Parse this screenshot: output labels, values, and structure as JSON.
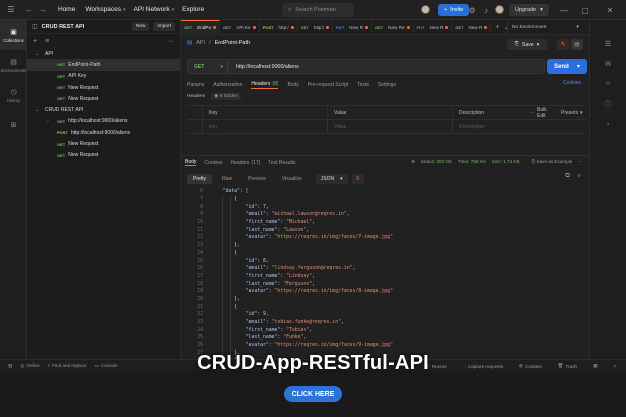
{
  "topbar": {
    "nav": [
      "Home",
      "Workspaces",
      "API Network",
      "Explore"
    ],
    "search_placeholder": "Search Postman",
    "invite_label": "Invite",
    "upgrade_label": "Upgrade"
  },
  "rail": {
    "items": [
      {
        "label": "Collections",
        "icon": "collections-icon"
      },
      {
        "label": "Environments",
        "icon": "environments-icon"
      },
      {
        "label": "History",
        "icon": "history-icon"
      },
      {
        "label": "",
        "icon": "apps-icon"
      }
    ]
  },
  "sidebar": {
    "workspace_title": "CRUD REST API",
    "new_label": "New",
    "import_label": "Import",
    "tree": [
      {
        "depth": 0,
        "chevron": "v",
        "method": "",
        "label": "API"
      },
      {
        "depth": 1,
        "chevron": "",
        "method": "GET",
        "label": "EndPoint-Path",
        "selected": true
      },
      {
        "depth": 1,
        "chevron": "",
        "method": "GET",
        "label": "API Key"
      },
      {
        "depth": 1,
        "chevron": "",
        "method": "GET",
        "label": "New Request"
      },
      {
        "depth": 1,
        "chevron": "",
        "method": "GET",
        "label": "New Request"
      },
      {
        "depth": 0,
        "chevron": "v",
        "method": "",
        "label": "CRUD REST API"
      },
      {
        "depth": 1,
        "chevron": ">",
        "method": "GET",
        "label": "http://localhost:9000/aliens"
      },
      {
        "depth": 1,
        "chevron": "",
        "method": "POST",
        "label": "http://localhost:9000/aliens"
      },
      {
        "depth": 1,
        "chevron": "",
        "method": "GET",
        "label": "New Request"
      },
      {
        "depth": 1,
        "chevron": "",
        "method": "GET",
        "label": "New Request"
      }
    ]
  },
  "tabs": [
    {
      "method": "GET",
      "label": "EndPo",
      "active": true
    },
    {
      "method": "GET",
      "label": "API Ke"
    },
    {
      "method": "POST",
      "label": "http:/"
    },
    {
      "method": "GET",
      "label": "http:/"
    },
    {
      "method": "PUT",
      "label": "New R"
    },
    {
      "method": "GET",
      "label": "New Re"
    },
    {
      "method": "PUT",
      "label": "New R"
    },
    {
      "method": "GET",
      "label": "New R"
    }
  ],
  "environment": "No Environment",
  "request": {
    "breadcrumb_parent": "API",
    "breadcrumb_current": "EndPoint-Path",
    "save_label": "Save",
    "method": "GET",
    "url": "http://localhost:9000/aliens",
    "send_label": "Send",
    "tabs": [
      {
        "label": "Params"
      },
      {
        "label": "Authorization"
      },
      {
        "label": "Headers",
        "count": "(8)",
        "active": true
      },
      {
        "label": "Body"
      },
      {
        "label": "Pre-request Script"
      },
      {
        "label": "Tests"
      },
      {
        "label": "Settings"
      }
    ],
    "cookies_label": "Cookies",
    "headers_label": "Headers",
    "hidden_label": "8 hidden",
    "table_headers": [
      "",
      "Key",
      "Value",
      "Description",
      "Bulk Edit",
      "Presets"
    ],
    "placeholders": [
      "Key",
      "Value",
      "Description"
    ]
  },
  "response": {
    "tabs": [
      {
        "label": "Body",
        "active": true
      },
      {
        "label": "Cookies"
      },
      {
        "label": "Headers",
        "count": "(17)"
      },
      {
        "label": "Test Results"
      }
    ],
    "status_label": "Status:",
    "status_value": "200 OK",
    "time_label": "Time:",
    "time_value": "768 ms",
    "size_label": "Size:",
    "size_value": "1.74 KB",
    "save_example": "Save as Example",
    "views": [
      "Pretty",
      "Raw",
      "Preview",
      "Visualize"
    ],
    "format": "JSON",
    "lines": [
      {
        "n": "6",
        "text": "    \"data\": ["
      },
      {
        "n": "7",
        "text": "        {"
      },
      {
        "n": "8",
        "text": "            \"id\": 7,"
      },
      {
        "n": "9",
        "text": "            \"email\": \"michael.lawson@reqres.in\","
      },
      {
        "n": "10",
        "text": "            \"first_name\": \"Michael\","
      },
      {
        "n": "11",
        "text": "            \"last_name\": \"Lawson\","
      },
      {
        "n": "12",
        "text": "            \"avatar\": \"https://reqres.in/img/faces/7-image.jpg\""
      },
      {
        "n": "13",
        "text": "        },"
      },
      {
        "n": "14",
        "text": "        {"
      },
      {
        "n": "15",
        "text": "            \"id\": 8,"
      },
      {
        "n": "16",
        "text": "            \"email\": \"lindsay.ferguson@reqres.in\","
      },
      {
        "n": "17",
        "text": "            \"first_name\": \"Lindsay\","
      },
      {
        "n": "18",
        "text": "            \"last_name\": \"Ferguson\","
      },
      {
        "n": "19",
        "text": "            \"avatar\": \"https://reqres.in/img/faces/8-image.jpg\""
      },
      {
        "n": "20",
        "text": "        },"
      },
      {
        "n": "21",
        "text": "        {"
      },
      {
        "n": "22",
        "text": "            \"id\": 9,"
      },
      {
        "n": "23",
        "text": "            \"email\": \"tobias.funke@reqres.in\","
      },
      {
        "n": "24",
        "text": "            \"first_name\": \"Tobias\","
      },
      {
        "n": "25",
        "text": "            \"last_name\": \"Funke\","
      },
      {
        "n": "26",
        "text": "            \"avatar\": \"https://reqres.in/img/faces/9-image.jpg\""
      },
      {
        "n": "27",
        "text": "        },"
      },
      {
        "n": "28",
        "text": "        {"
      }
    ]
  },
  "footer": {
    "left": [
      "Online",
      "Find and replace",
      "Console"
    ],
    "right": [
      "Runner",
      "Capture requests",
      "Cookies",
      "Trash"
    ]
  },
  "promo": {
    "title": "CRUD-App-RESTful-API",
    "cta": "CLICK HERE"
  },
  "colors": {
    "accent": "#f26b3a",
    "send": "#2b6fdc",
    "get": "#6bbd5b",
    "post": "#e7b74e",
    "put": "#4b8fe8"
  }
}
